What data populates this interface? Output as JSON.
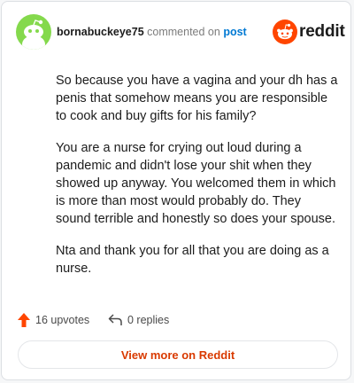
{
  "header": {
    "username": "bornabuckeye75",
    "action": "commented on",
    "post_link": "post",
    "logo_text": "reddit"
  },
  "comment": {
    "paragraphs": [
      "So because you have a vagina and your dh has a penis that somehow means you are responsible to cook and buy gifts for his family?",
      "You are a nurse for crying out loud during a pandemic and didn't lose your shit when they showed up anyway. You welcomed them in which is more than most would probably do. They sound terrible and honestly so does your spouse.",
      "Nta and thank you for all that you are doing as a nurse."
    ]
  },
  "footer": {
    "upvotes": "16 upvotes",
    "replies": "0 replies"
  },
  "cta": {
    "label": "View more on Reddit"
  },
  "colors": {
    "accent_orange": "#ff4500",
    "link_blue": "#0079d3",
    "cta_red": "#d93a00",
    "avatar_green": "#84d94c"
  },
  "icons": [
    "snoo-avatar-icon",
    "reddit-logo-icon",
    "upvote-arrow-icon",
    "reply-arrow-icon"
  ]
}
